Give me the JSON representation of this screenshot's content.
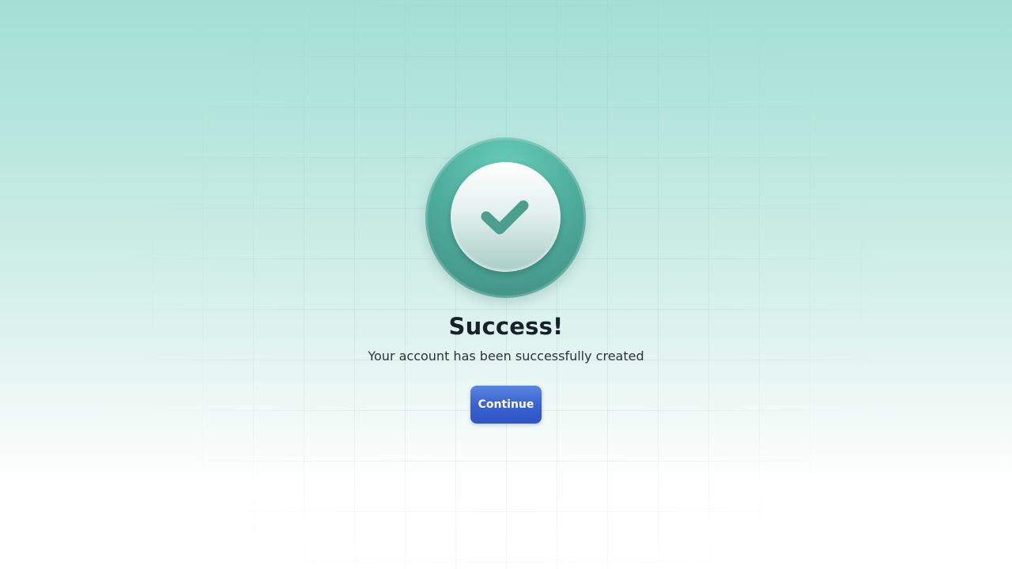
{
  "dialog": {
    "icon": "check-icon",
    "title": "Success!",
    "message": "Your account has been successfully created",
    "continue_label": "Continue"
  },
  "colors": {
    "badge_outer": "#4fae9d",
    "check": "#4e9e90",
    "button": "#3a63d0",
    "title_text": "#17202b",
    "background_top": "#a3dfd4"
  }
}
